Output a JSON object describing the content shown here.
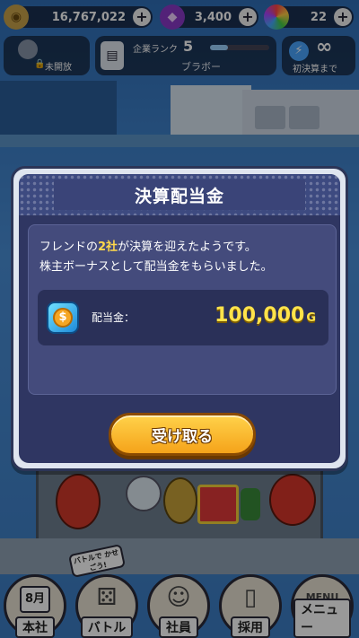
{
  "topbar": {
    "money": "16,767,022",
    "gems": "3,400",
    "orbs": "22",
    "money_icon": "coin-icon",
    "gem_icon": "gem-icon",
    "orb_icon": "rainbow-orb-icon"
  },
  "status_row": {
    "head_label": "未開放",
    "rank_title": "企業ランク",
    "rank_value": "5",
    "rank_progress": 0.3,
    "rank_name": "ブラボー",
    "settlement_value": "∞",
    "settlement_label": "初決算まで"
  },
  "dialog": {
    "title": "決算配当金",
    "message_prefix": "フレンドの",
    "message_highlight": "2社",
    "message_suffix": "が決算を迎えたようです。",
    "message_line2": "株主ボーナスとして配当金をもらいました。",
    "reward_label": "配当金：",
    "reward_amount": "100,000",
    "reward_unit": "G",
    "receive_button": "受け取る"
  },
  "nav": {
    "hq_month": "8月",
    "hq_label": "本社",
    "battle_label": "バトル",
    "battle_badge": "バトルで かせごう!",
    "staff_label": "社員",
    "hire_label": "採用",
    "menu_label": "メニュー",
    "menu_book": "MENU"
  },
  "colors": {
    "accent_gold": "#ffe34a",
    "dialog_bg": "#2f3662",
    "button_orange": "#f5a31a"
  }
}
